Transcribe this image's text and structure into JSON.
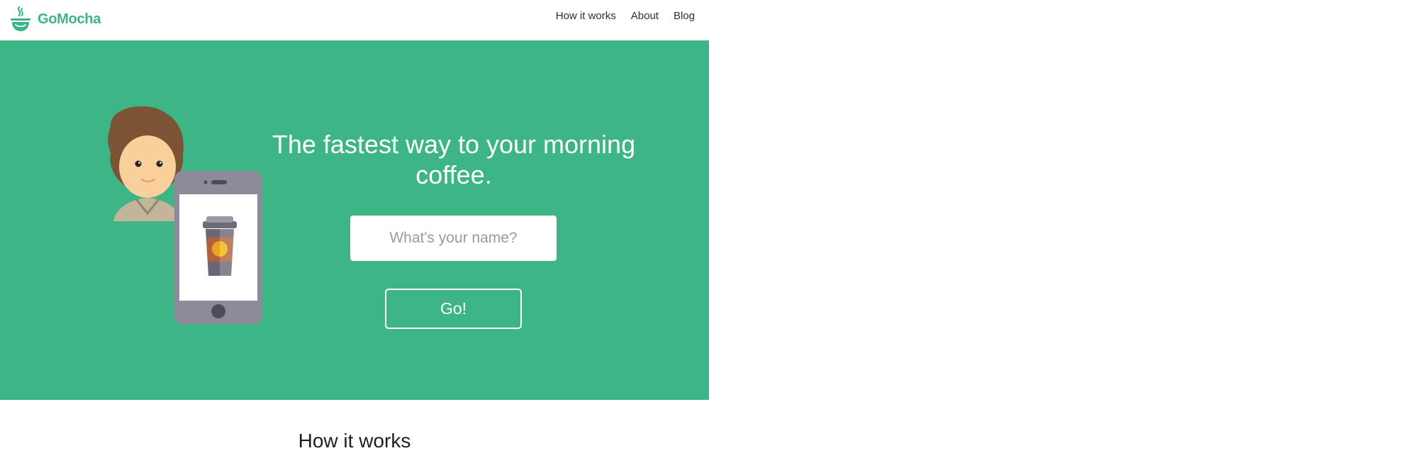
{
  "brand": {
    "name": "GoMocha",
    "color": "#3bb585",
    "logo_icon": "steaming-cup-icon"
  },
  "nav": {
    "links": [
      {
        "label": "How it works"
      },
      {
        "label": "About"
      },
      {
        "label": "Blog"
      }
    ]
  },
  "hero": {
    "background": "#3db587",
    "title": "The fastest way to your morning coffee.",
    "name_input": {
      "value": "",
      "placeholder": "What's your name?"
    },
    "go_label": "Go!",
    "illustration": "person-with-phone-showing-coffee-cup"
  },
  "section": {
    "title": "How it works"
  }
}
